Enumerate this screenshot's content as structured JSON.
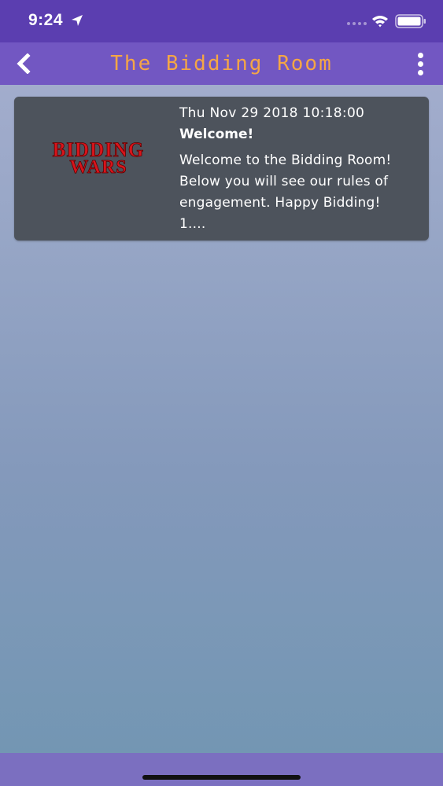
{
  "status_bar": {
    "time": "9:24",
    "icons": [
      "location-arrow-icon",
      "signal-icon",
      "wifi-icon",
      "battery-icon"
    ]
  },
  "nav": {
    "title": "The Bidding Room",
    "back_icon": "chevron-left-icon",
    "menu_icon": "more-vertical-icon"
  },
  "messages": [
    {
      "logo_text": "BIDDING WARS",
      "date": "Thu Nov 29 2018 10:18:00",
      "title": "Welcome!",
      "body": "Welcome to the Bidding Room!\nBelow you will see our rules of engagement. Happy Bidding!\n1...."
    }
  ],
  "colors": {
    "status_bar": "#5b3eb0",
    "nav_bar": "#7257c2",
    "title_accent": "#f5a645",
    "card_bg": "#4d535c",
    "logo_red": "#d9141b",
    "bottom_bar": "#7b6fc0"
  }
}
